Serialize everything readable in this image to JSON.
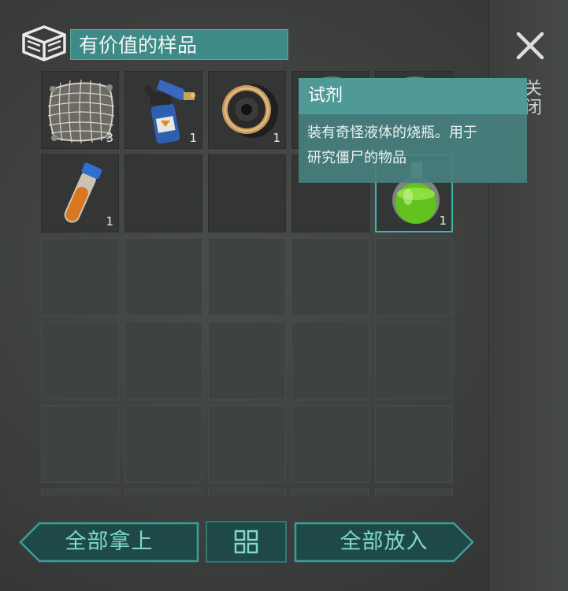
{
  "container": {
    "title": "有价值的样品",
    "side_label": "关闭"
  },
  "slots": [
    {
      "item": "net",
      "qty": "3"
    },
    {
      "item": "blowtorch",
      "qty": "1"
    },
    {
      "item": "speaker",
      "qty": "1"
    },
    {
      "item": "covered",
      "qty": ""
    },
    {
      "item": "covered",
      "qty": ""
    },
    {
      "item": "test-tube",
      "qty": "1"
    },
    {
      "item": "empty",
      "qty": ""
    },
    {
      "item": "empty",
      "qty": ""
    },
    {
      "item": "empty",
      "qty": ""
    },
    {
      "item": "flask",
      "qty": "1"
    }
  ],
  "tooltip": {
    "title": "试剂",
    "description_line1": "装有奇怪液体的烧瓶。用于",
    "description_line2": "研究僵尸的物品"
  },
  "buttons": {
    "take_all": "全部拿上",
    "put_all": "全部放入"
  },
  "colors": {
    "accent": "#3fb3ac",
    "title_bg": "#3d8a86",
    "tooltip_bg": "#46807e",
    "button_text": "#7fd6cf"
  },
  "icons": [
    "storage-box-icon",
    "close-icon",
    "grid-view-icon"
  ]
}
